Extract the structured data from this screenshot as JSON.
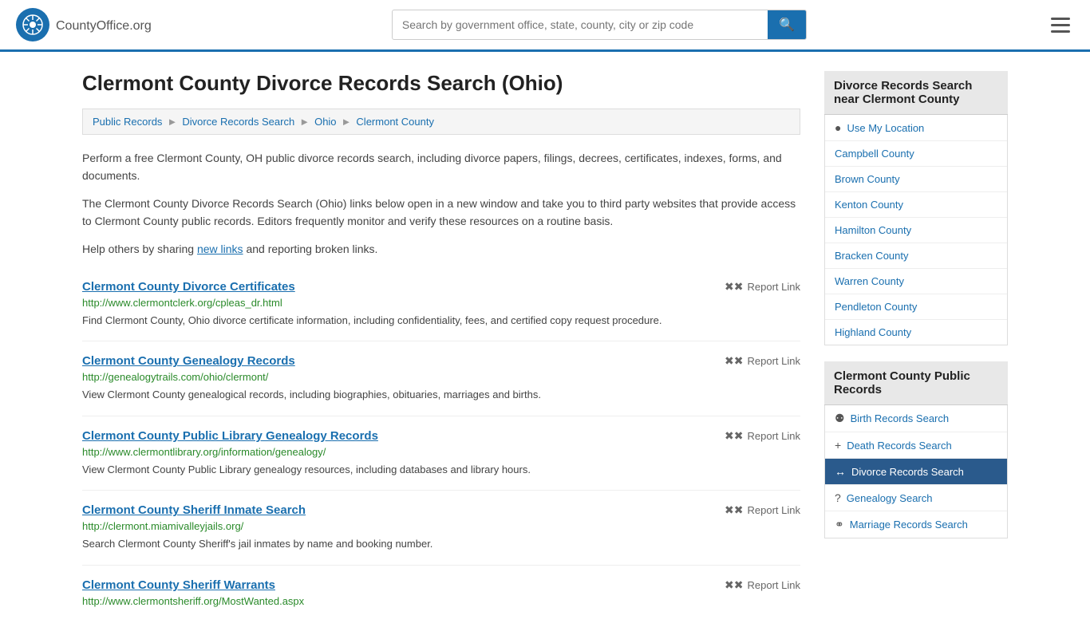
{
  "header": {
    "logo_text": "CountyOffice",
    "logo_suffix": ".org",
    "search_placeholder": "Search by government office, state, county, city or zip code"
  },
  "page": {
    "title": "Clermont County Divorce Records Search (Ohio)"
  },
  "breadcrumb": {
    "items": [
      {
        "label": "Public Records",
        "href": "#"
      },
      {
        "label": "Divorce Records Search",
        "href": "#"
      },
      {
        "label": "Ohio",
        "href": "#"
      },
      {
        "label": "Clermont County",
        "href": "#"
      }
    ]
  },
  "description": {
    "para1": "Perform a free Clermont County, OH public divorce records search, including divorce papers, filings, decrees, certificates, indexes, forms, and documents.",
    "para2": "The Clermont County Divorce Records Search (Ohio) links below open in a new window and take you to third party websites that provide access to Clermont County public records. Editors frequently monitor and verify these resources on a routine basis.",
    "para3_start": "Help others by sharing ",
    "para3_link": "new links",
    "para3_end": " and reporting broken links."
  },
  "results": [
    {
      "title": "Clermont County Divorce Certificates",
      "url": "http://www.clermontclerk.org/cpleas_dr.html",
      "desc": "Find Clermont County, Ohio divorce certificate information, including confidentiality, fees, and certified copy request procedure.",
      "report_label": "Report Link"
    },
    {
      "title": "Clermont County Genealogy Records",
      "url": "http://genealogytrails.com/ohio/clermont/",
      "desc": "View Clermont County genealogical records, including biographies, obituaries, marriages and births.",
      "report_label": "Report Link"
    },
    {
      "title": "Clermont County Public Library Genealogy Records",
      "url": "http://www.clermontlibrary.org/information/genealogy/",
      "desc": "View Clermont County Public Library genealogy resources, including databases and library hours.",
      "report_label": "Report Link"
    },
    {
      "title": "Clermont County Sheriff Inmate Search",
      "url": "http://clermont.miamivalleyjails.org/",
      "desc": "Search Clermont County Sheriff's jail inmates by name and booking number.",
      "report_label": "Report Link"
    },
    {
      "title": "Clermont County Sheriff Warrants",
      "url": "http://www.clermontsheriff.org/MostWanted.aspx",
      "desc": "",
      "report_label": "Report Link"
    }
  ],
  "sidebar": {
    "nearby_title": "Divorce Records Search near Clermont County",
    "use_my_location": "Use My Location",
    "nearby_counties": [
      {
        "label": "Campbell County"
      },
      {
        "label": "Brown County"
      },
      {
        "label": "Kenton County"
      },
      {
        "label": "Hamilton County"
      },
      {
        "label": "Bracken County"
      },
      {
        "label": "Warren County"
      },
      {
        "label": "Pendleton County"
      },
      {
        "label": "Highland County"
      }
    ],
    "public_records_title": "Clermont County Public Records",
    "public_records": [
      {
        "label": "Birth Records Search",
        "icon": "birth",
        "active": false
      },
      {
        "label": "Death Records Search",
        "icon": "cross",
        "active": false
      },
      {
        "label": "Divorce Records Search",
        "icon": "arrows",
        "active": true
      },
      {
        "label": "Genealogy Search",
        "icon": "question",
        "active": false
      },
      {
        "label": "Marriage Records Search",
        "icon": "rings",
        "active": false
      }
    ]
  }
}
